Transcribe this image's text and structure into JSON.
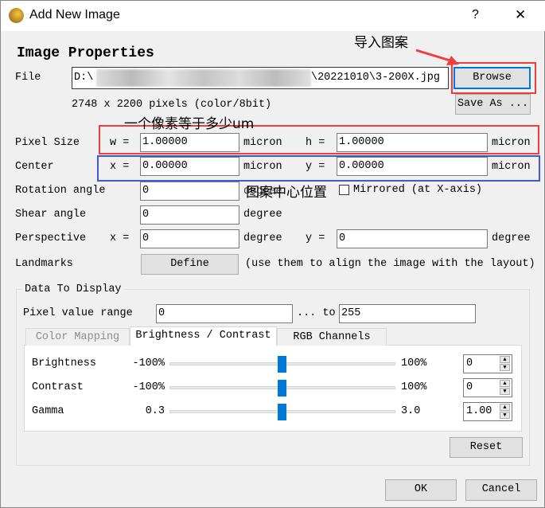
{
  "window": {
    "title": "Add New Image",
    "help": "?",
    "close": "✕"
  },
  "section_title": "Image Properties",
  "file": {
    "label": "File",
    "path_prefix": "D:\\",
    "path_suffix": "\\20221010\\3-200X.jpg",
    "browse": "Browse",
    "save_as": "Save As ...",
    "info": "2748 x 2200 pixels (color/8bit)"
  },
  "pixel_size": {
    "label": "Pixel Size",
    "w_label": "w =",
    "w": "1.00000",
    "w_unit": "micron",
    "h_label": "h =",
    "h": "1.00000",
    "h_unit": "micron"
  },
  "center": {
    "label": "Center",
    "x_label": "x =",
    "x": "0.00000",
    "x_unit": "micron",
    "y_label": "y =",
    "y": "0.00000",
    "y_unit": "micron"
  },
  "rotation": {
    "label": "Rotation angle",
    "value": "0",
    "unit": "degree",
    "mirrored": "Mirrored (at X-axis)",
    "mirrored_checked": false
  },
  "shear": {
    "label": "Shear angle",
    "value": "0",
    "unit": "degree"
  },
  "perspective": {
    "label": "Perspective",
    "x_label": "x =",
    "x": "0",
    "x_unit": "degree",
    "y_label": "y =",
    "y": "0",
    "y_unit": "degree"
  },
  "landmarks": {
    "label": "Landmarks",
    "define": "Define",
    "hint": "(use them to align the image with the layout)"
  },
  "display": {
    "title": "Data To Display",
    "range_label": "Pixel value range",
    "range_from": "0",
    "range_to_label": "... to",
    "range_to": "255",
    "tabs": [
      {
        "label": "Color Mapping",
        "state": "disabled"
      },
      {
        "label": "Brightness / Contrast",
        "state": "active"
      },
      {
        "label": "RGB Channels",
        "state": "normal"
      }
    ],
    "rows": [
      {
        "label": "Brightness",
        "min": "-100%",
        "max": "100%",
        "value": "0",
        "slider_fraction": 0.5
      },
      {
        "label": "Contrast",
        "min": "-100%",
        "max": "100%",
        "value": "0",
        "slider_fraction": 0.5
      },
      {
        "label": "Gamma",
        "min": "0.3",
        "max": "3.0",
        "value": "1.00",
        "slider_fraction": 0.5
      }
    ],
    "reset": "Reset"
  },
  "ok": "OK",
  "cancel": "Cancel",
  "annotations": {
    "import": "导入图案",
    "pixel": "一个像素等于多少um",
    "center": "图案中心位置",
    "red": "#f03c3c",
    "blue": "#3c5ad2"
  },
  "accent": "#0078d7"
}
